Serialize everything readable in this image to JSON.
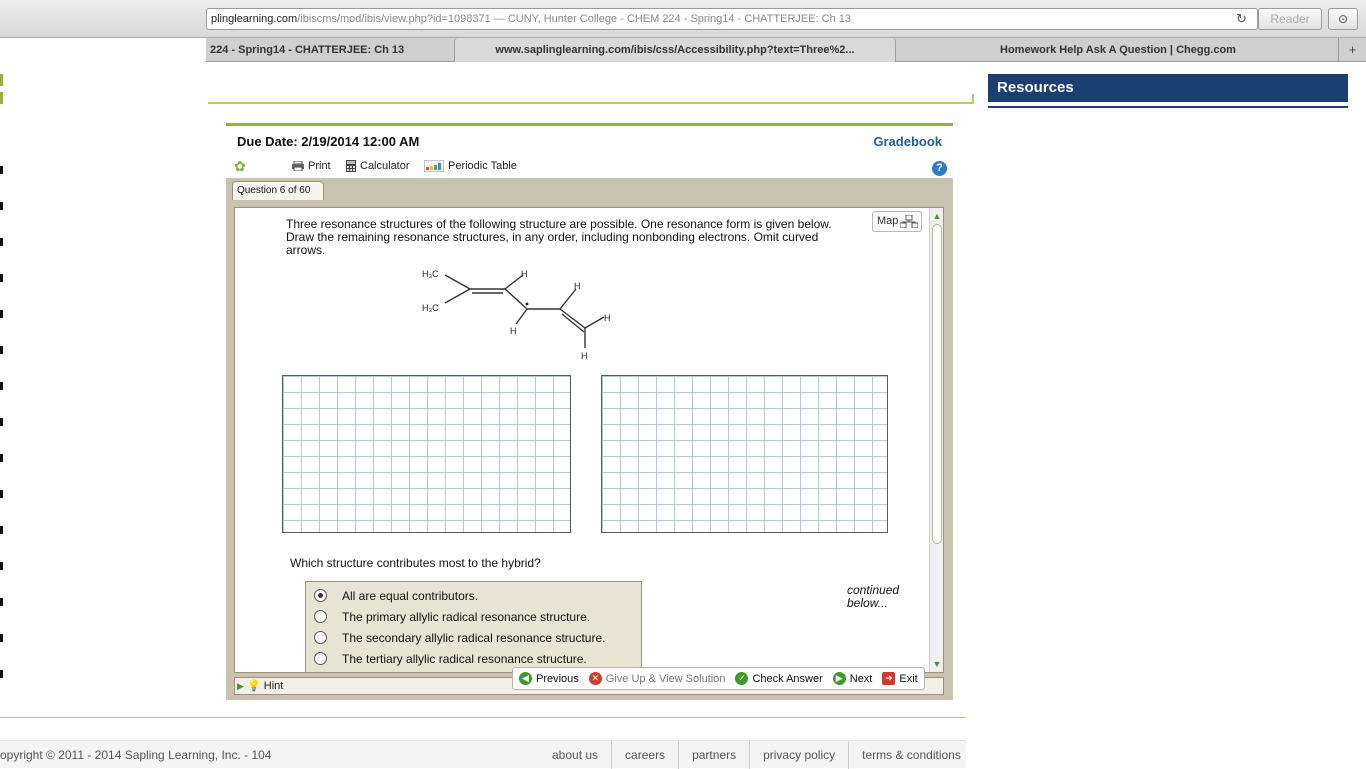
{
  "browser": {
    "url_host": "plinglearning.com",
    "url_rest": "/ibiscms/mod/ibis/view.php?id=1098371 — CUNY, Hunter College - CHEM 224 - Spring14 - CHATTERJEE: Ch 13",
    "reader_label": "Reader",
    "refresh_glyph": "↻",
    "download_glyph": "⊙",
    "tabs": [
      {
        "label": "224 - Spring14 - CHATTERJEE: Ch 13"
      },
      {
        "label": "www.saplinglearning.com/ibis/css/Accessibility.php?text=Three%2..."
      },
      {
        "label": "Homework Help Ask A Question | Chegg.com"
      }
    ],
    "new_tab_glyph": "+"
  },
  "sidebar": {
    "resources_title": "Resources"
  },
  "assignment": {
    "due_date": "Due Date:  2/19/2014 12:00 AM",
    "gradebook": "Gradebook",
    "tools": {
      "print": "Print",
      "calculator": "Calculator",
      "periodic_table": "Periodic Table"
    },
    "help_glyph": "?",
    "question_tab": "Question 6 of 60",
    "map_label": "Map",
    "prompt": "Three resonance structures of the following structure are possible. One resonance form is given below.  Draw the remaining resonance structures, in any order, including nonbonding electrons. Omit curved arrows.",
    "molecule": {
      "ch3_top": "H₃C",
      "ch3_bottom": "H₃C",
      "h": "H"
    },
    "hybrid_question": "Which structure contributes most to the hybrid?",
    "options": [
      {
        "label": "All are equal contributors.",
        "selected": true
      },
      {
        "label": "The primary allylic radical resonance structure.",
        "selected": false
      },
      {
        "label": "The secondary allylic radical resonance structure.",
        "selected": false
      },
      {
        "label": "The tertiary allylic radical resonance structure.",
        "selected": false
      }
    ],
    "continued": "continued below...",
    "hint": "Hint",
    "nav": {
      "previous": "Previous",
      "give_up": "Give Up & View Solution",
      "check": "Check Answer",
      "next": "Next",
      "exit": "Exit"
    }
  },
  "footer": {
    "copyright": "opyright © 2011 - 2014 Sapling Learning, Inc. - 104",
    "links": [
      "about us",
      "careers",
      "partners",
      "privacy policy",
      "terms & conditions"
    ]
  },
  "colors": {
    "accent_green": "#8fb43a",
    "resources_blue": "#1b3f73",
    "gradebook_blue": "#1f5f95"
  }
}
